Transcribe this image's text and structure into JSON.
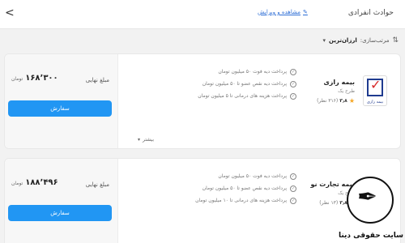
{
  "header": {
    "title": "حوادث انفرادی",
    "edit_link": "مشاهده و ویرایش",
    "back_icon": "share-icon"
  },
  "sort": {
    "label": "مرتب‌سازی:",
    "value": "ارزان‌ترین"
  },
  "cards": [
    {
      "insurer": "بیمه رازی",
      "plan": "طرح یک",
      "rating": "۳٫۸",
      "reviews": "(۳۱۶ نظر)",
      "logo_text": "بیمه رازی",
      "features": [
        "پرداخت دیه فوت ۵۰ میلیون تومان",
        "پرداخت دیه نقص عضو تا ۵۰ میلیون تومان",
        "پرداخت هزینه های درمانی تا ۵ میلیون تومان"
      ],
      "price_label": "مبلغ نهایی",
      "price": "۱۶۸٬۳۰۰",
      "price_unit": "تومان",
      "order_label": "سفارش",
      "more_label": "بیشتر"
    },
    {
      "insurer": "بیمه تجارت نو",
      "plan": "طرح یک",
      "rating": "۳٫۸",
      "reviews": "(۱۳ نظر)",
      "features": [
        "پرداخت دیه فوت ۵۰ میلیون تومان",
        "پرداخت دیه نقص عضو تا ۵۰ میلیون تومان",
        "پرداخت هزینه های درمانی تا ۱۰ میلیون تومان"
      ],
      "price_label": "مبلغ نهایی",
      "price": "۱۸۸٬۴۹۶",
      "price_unit": "تومان",
      "order_label": "سفارش"
    }
  ],
  "watermark": {
    "text": "سایت حقوقی دینا"
  }
}
